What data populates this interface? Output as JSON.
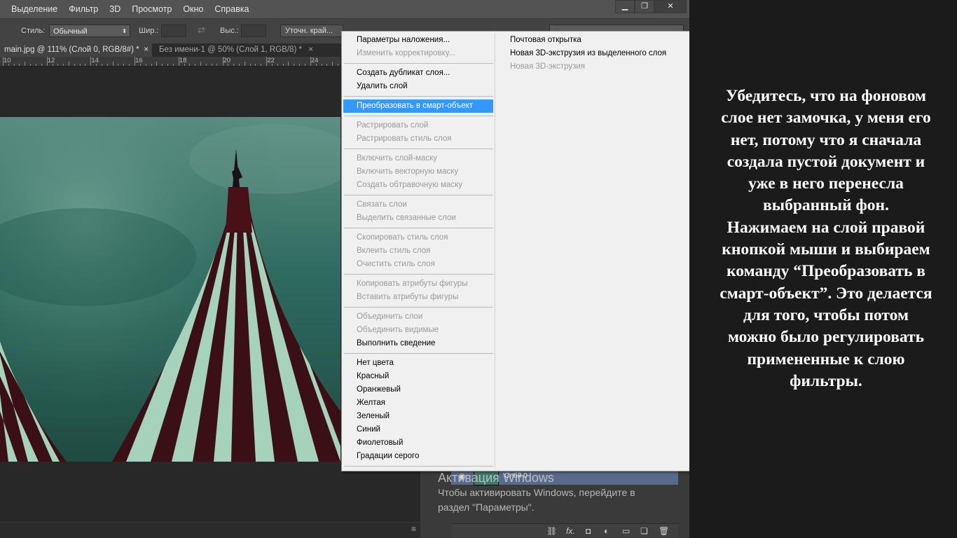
{
  "menubar": {
    "items": [
      "Выделение",
      "Фильтр",
      "3D",
      "Просмотр",
      "Окно",
      "Справка"
    ],
    "window_buttons": {
      "minimize": "▁",
      "restore": "❐",
      "close": "✕"
    }
  },
  "options": {
    "style_label": "Стиль:",
    "style_value": "Обычный",
    "width_label": "Шир.:",
    "height_label": "Выс.:",
    "refine_button": "Уточн. край..."
  },
  "tabs": [
    {
      "label": "main.jpg @ 111% (Слой 0, RGB/8#) *",
      "close": "×"
    },
    {
      "label": "Без имени-1 @ 50% (Слой 1, RGB/8) *",
      "close": "×"
    }
  ],
  "ruler": {
    "labels": [
      "10",
      "12",
      "14",
      "16",
      "18",
      "20",
      "22",
      "24"
    ]
  },
  "context_menu": {
    "col1": [
      {
        "label": "Параметры наложения...",
        "state": "normal"
      },
      {
        "label": "Изменить корректировку...",
        "state": "disabled"
      },
      {
        "sep": true
      },
      {
        "label": "Создать дубликат слоя...",
        "state": "normal"
      },
      {
        "label": "Удалить слой",
        "state": "normal"
      },
      {
        "sep": true
      },
      {
        "label": "Преобразовать в смарт-объект",
        "state": "highlighted"
      },
      {
        "sep": true
      },
      {
        "label": "Растрировать слой",
        "state": "disabled"
      },
      {
        "label": "Растрировать стиль слоя",
        "state": "disabled"
      },
      {
        "sep": true
      },
      {
        "label": "Включить слой-маску",
        "state": "disabled"
      },
      {
        "label": "Включить векторную маску",
        "state": "disabled"
      },
      {
        "label": "Создать обтравочную маску",
        "state": "disabled"
      },
      {
        "sep": true
      },
      {
        "label": "Связать слои",
        "state": "disabled"
      },
      {
        "label": "Выделить связанные слои",
        "state": "disabled"
      },
      {
        "sep": true
      },
      {
        "label": "Скопировать стиль слоя",
        "state": "disabled"
      },
      {
        "label": "Вклеить стиль слоя",
        "state": "disabled"
      },
      {
        "label": "Очистить стиль слоя",
        "state": "disabled"
      },
      {
        "sep": true
      },
      {
        "label": "Копировать атрибуты фигуры",
        "state": "disabled"
      },
      {
        "label": "Вставить атрибуты фигуры",
        "state": "disabled"
      },
      {
        "sep": true
      },
      {
        "label": "Объединить слои",
        "state": "disabled"
      },
      {
        "label": "Объединить видимые",
        "state": "disabled"
      },
      {
        "label": "Выполнить сведение",
        "state": "normal"
      },
      {
        "sep": true
      },
      {
        "label": "Нет цвета",
        "state": "normal"
      },
      {
        "label": "Красный",
        "state": "normal"
      },
      {
        "label": "Оранжевый",
        "state": "normal"
      },
      {
        "label": "Желтая",
        "state": "normal"
      },
      {
        "label": "Зеленый",
        "state": "normal"
      },
      {
        "label": "Синий",
        "state": "normal"
      },
      {
        "label": "Фиолетовый",
        "state": "normal"
      },
      {
        "label": "Градации серого",
        "state": "normal"
      },
      {
        "sep": true
      }
    ],
    "col2": [
      {
        "label": "Почтовая открытка",
        "state": "normal"
      },
      {
        "label": "Новая 3D-экструзия из выделенного слоя",
        "state": "normal"
      },
      {
        "label": "Новая 3D-экструзия",
        "state": "disabled"
      }
    ]
  },
  "layers_panel": {
    "layer_name": "Слой 0",
    "watermark_title": "Активация Windows",
    "watermark_line1": "Чтобы активировать Windows, перейдите в",
    "watermark_line2": "раздел \"Параметры\"."
  },
  "note": {
    "lines": [
      "Убедитесь, что на фоновом",
      "слое нет замочка, у меня его",
      "нет, потому что я сначала",
      "создала пустой документ и",
      "уже в него перенесла",
      "выбранный фон.",
      "Нажимаем на слой правой",
      "кнопкой мыши и выбираем",
      "команду “Преобразовать в",
      "смарт-объект”. Это делается",
      "для того, чтобы потом",
      "можно было регулировать",
      "примененные к слою",
      "фильтры."
    ]
  },
  "colors": {
    "highlight": "#3399ff",
    "sky": "#2f6b5f",
    "stripe_dark": "#3a0f16",
    "stripe_light": "#a6d2bc"
  }
}
